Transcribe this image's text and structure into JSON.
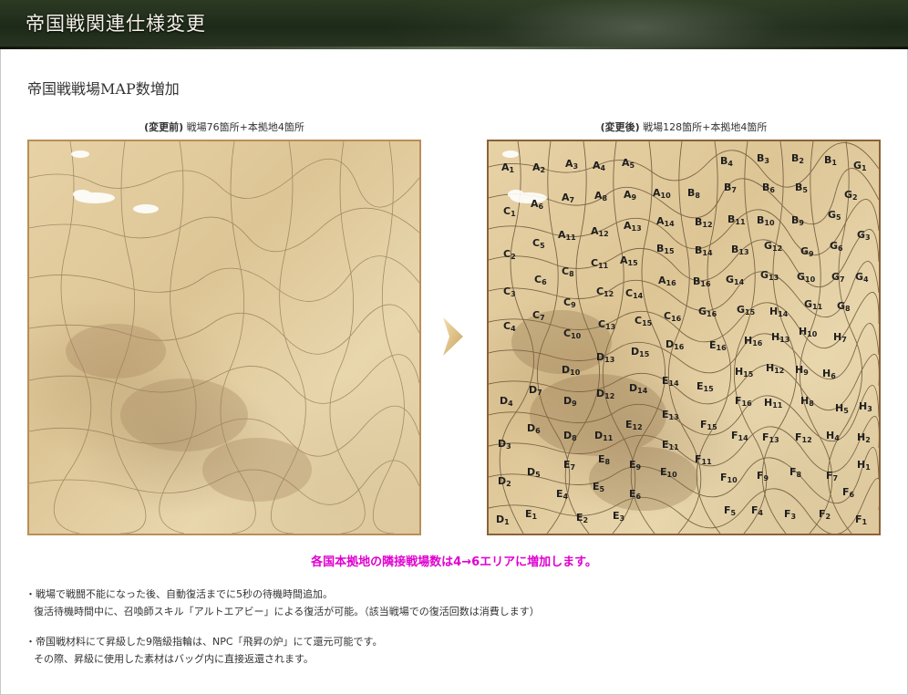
{
  "header": {
    "title": "帝国戦関連仕様変更"
  },
  "section": {
    "title": "帝国戦戦場MAP数増加"
  },
  "before": {
    "tag": "(変更前)",
    "text": "戦場76箇所+本拠地4箇所"
  },
  "after": {
    "tag": "(変更後)",
    "text": "戦場128箇所+本拠地4箇所"
  },
  "notice": "各国本拠地の隣接戦場数は4→6エリアに増加します。",
  "bullets": [
    {
      "line1": "・戦場で戦闘不能になった後、自動復活までに5秒の待機時間追加。",
      "line2": "復活待機時間中に、召喚師スキル「アルトエアビー」による復活が可能。（該当戦場での復活回数は消費します）"
    },
    {
      "line1": "・帝国戦材料にて昇級した9階級指輪は、NPC「飛昇の炉」にて還元可能です。",
      "line2": "その際、昇級に使用した素材はバッグ内に直接返還されます。"
    }
  ],
  "colors": {
    "notice": "#e000d0",
    "header_bg": "#253020",
    "map_border": "#b98f57"
  },
  "map_labels": [
    {
      "l": "A",
      "n": "1"
    },
    {
      "l": "A",
      "n": "2"
    },
    {
      "l": "A",
      "n": "3"
    },
    {
      "l": "A",
      "n": "4"
    },
    {
      "l": "A",
      "n": "5"
    },
    {
      "l": "A",
      "n": "6"
    },
    {
      "l": "A",
      "n": "7"
    },
    {
      "l": "A",
      "n": "8"
    },
    {
      "l": "A",
      "n": "9"
    },
    {
      "l": "A",
      "n": "10"
    },
    {
      "l": "A",
      "n": "11"
    },
    {
      "l": "A",
      "n": "12"
    },
    {
      "l": "A",
      "n": "13"
    },
    {
      "l": "A",
      "n": "14"
    },
    {
      "l": "A",
      "n": "15"
    },
    {
      "l": "A",
      "n": "16"
    },
    {
      "l": "B",
      "n": "1"
    },
    {
      "l": "B",
      "n": "2"
    },
    {
      "l": "B",
      "n": "3"
    },
    {
      "l": "B",
      "n": "4"
    },
    {
      "l": "B",
      "n": "5"
    },
    {
      "l": "B",
      "n": "6"
    },
    {
      "l": "B",
      "n": "7"
    },
    {
      "l": "B",
      "n": "8"
    },
    {
      "l": "B",
      "n": "9"
    },
    {
      "l": "B",
      "n": "10"
    },
    {
      "l": "B",
      "n": "11"
    },
    {
      "l": "B",
      "n": "12"
    },
    {
      "l": "B",
      "n": "13"
    },
    {
      "l": "B",
      "n": "14"
    },
    {
      "l": "B",
      "n": "15"
    },
    {
      "l": "B",
      "n": "16"
    },
    {
      "l": "C",
      "n": "1"
    },
    {
      "l": "C",
      "n": "2"
    },
    {
      "l": "C",
      "n": "3"
    },
    {
      "l": "C",
      "n": "4"
    },
    {
      "l": "C",
      "n": "5"
    },
    {
      "l": "C",
      "n": "6"
    },
    {
      "l": "C",
      "n": "7"
    },
    {
      "l": "C",
      "n": "8"
    },
    {
      "l": "C",
      "n": "9"
    },
    {
      "l": "C",
      "n": "10"
    },
    {
      "l": "C",
      "n": "11"
    },
    {
      "l": "C",
      "n": "12"
    },
    {
      "l": "C",
      "n": "13"
    },
    {
      "l": "C",
      "n": "14"
    },
    {
      "l": "C",
      "n": "15"
    },
    {
      "l": "C",
      "n": "16"
    },
    {
      "l": "D",
      "n": "1"
    },
    {
      "l": "D",
      "n": "2"
    },
    {
      "l": "D",
      "n": "3"
    },
    {
      "l": "D",
      "n": "4"
    },
    {
      "l": "D",
      "n": "5"
    },
    {
      "l": "D",
      "n": "6"
    },
    {
      "l": "D",
      "n": "7"
    },
    {
      "l": "D",
      "n": "8"
    },
    {
      "l": "D",
      "n": "9"
    },
    {
      "l": "D",
      "n": "10"
    },
    {
      "l": "D",
      "n": "11"
    },
    {
      "l": "D",
      "n": "12"
    },
    {
      "l": "D",
      "n": "13"
    },
    {
      "l": "D",
      "n": "14"
    },
    {
      "l": "D",
      "n": "15"
    },
    {
      "l": "D",
      "n": "16"
    },
    {
      "l": "E",
      "n": "1"
    },
    {
      "l": "E",
      "n": "2"
    },
    {
      "l": "E",
      "n": "3"
    },
    {
      "l": "E",
      "n": "4"
    },
    {
      "l": "E",
      "n": "5"
    },
    {
      "l": "E",
      "n": "6"
    },
    {
      "l": "E",
      "n": "7"
    },
    {
      "l": "E",
      "n": "8"
    },
    {
      "l": "E",
      "n": "9"
    },
    {
      "l": "E",
      "n": "10"
    },
    {
      "l": "E",
      "n": "11"
    },
    {
      "l": "E",
      "n": "12"
    },
    {
      "l": "E",
      "n": "13"
    },
    {
      "l": "E",
      "n": "14"
    },
    {
      "l": "E",
      "n": "15"
    },
    {
      "l": "E",
      "n": "16"
    },
    {
      "l": "F",
      "n": "1"
    },
    {
      "l": "F",
      "n": "2"
    },
    {
      "l": "F",
      "n": "3"
    },
    {
      "l": "F",
      "n": "4"
    },
    {
      "l": "F",
      "n": "5"
    },
    {
      "l": "F",
      "n": "6"
    },
    {
      "l": "F",
      "n": "7"
    },
    {
      "l": "F",
      "n": "8"
    },
    {
      "l": "F",
      "n": "9"
    },
    {
      "l": "F",
      "n": "10"
    },
    {
      "l": "F",
      "n": "11"
    },
    {
      "l": "F",
      "n": "12"
    },
    {
      "l": "F",
      "n": "13"
    },
    {
      "l": "F",
      "n": "14"
    },
    {
      "l": "F",
      "n": "15"
    },
    {
      "l": "F",
      "n": "16"
    },
    {
      "l": "G",
      "n": "1"
    },
    {
      "l": "G",
      "n": "2"
    },
    {
      "l": "G",
      "n": "3"
    },
    {
      "l": "G",
      "n": "4"
    },
    {
      "l": "G",
      "n": "5"
    },
    {
      "l": "G",
      "n": "6"
    },
    {
      "l": "G",
      "n": "7"
    },
    {
      "l": "G",
      "n": "8"
    },
    {
      "l": "G",
      "n": "9"
    },
    {
      "l": "G",
      "n": "10"
    },
    {
      "l": "G",
      "n": "11"
    },
    {
      "l": "G",
      "n": "12"
    },
    {
      "l": "G",
      "n": "13"
    },
    {
      "l": "G",
      "n": "14"
    },
    {
      "l": "G",
      "n": "15"
    },
    {
      "l": "G",
      "n": "16"
    },
    {
      "l": "H",
      "n": "1"
    },
    {
      "l": "H",
      "n": "2"
    },
    {
      "l": "H",
      "n": "3"
    },
    {
      "l": "H",
      "n": "4"
    },
    {
      "l": "H",
      "n": "5"
    },
    {
      "l": "H",
      "n": "6"
    },
    {
      "l": "H",
      "n": "7"
    },
    {
      "l": "H",
      "n": "8"
    },
    {
      "l": "H",
      "n": "9"
    },
    {
      "l": "H",
      "n": "10"
    },
    {
      "l": "H",
      "n": "11"
    },
    {
      "l": "H",
      "n": "12"
    },
    {
      "l": "H",
      "n": "13"
    },
    {
      "l": "H",
      "n": "14"
    },
    {
      "l": "H",
      "n": "15"
    },
    {
      "l": "H",
      "n": "16"
    }
  ]
}
